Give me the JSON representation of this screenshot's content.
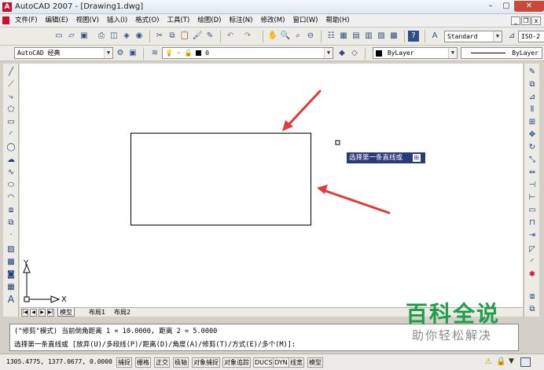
{
  "window": {
    "title": "AutoCAD 2007 - [Drawing1.dwg]",
    "controls": [
      "–",
      "▢",
      "✕"
    ],
    "doc_controls": [
      "_",
      "❐",
      "x"
    ]
  },
  "menu": {
    "items": [
      "文件(F)",
      "编辑(E)",
      "视图(V)",
      "插入(I)",
      "格式(O)",
      "工具(T)",
      "绘图(D)",
      "标注(N)",
      "修改(M)",
      "窗口(W)",
      "帮助(H)"
    ]
  },
  "toolbar": {
    "text_style": "Standard",
    "dim_style": "ISO-2",
    "workspace": "AutoCAD 经典",
    "layer": "0",
    "color": "ByLayer",
    "linetype": "ByLayer"
  },
  "drawing": {
    "tooltip": "选择第一条直线或",
    "tooltip_icon": "⊞",
    "ucs": {
      "x": "X",
      "y": "Y"
    },
    "arrow_color": "#e03a3a"
  },
  "tabs": {
    "items": [
      "模型",
      "布局1",
      "布局2"
    ],
    "nav": [
      "|◀",
      "◀",
      "▶",
      "▶|"
    ]
  },
  "command": {
    "history": "(\"修剪\"模式) 当前倒角距离 1 = 10.0000, 距离 2 = 5.0000",
    "prompt": "选择第一条直线或 [放弃(U)/多段线(P)/距离(D)/角度(A)/修剪(T)/方式(E)/多个(M)]:"
  },
  "status": {
    "coords": "1305.4775, 1377.0677, 0.0000",
    "buttons": [
      "捕捉",
      "栅格",
      "正交",
      "极轴",
      "对象捕捉",
      "对象追踪",
      "DUCS",
      "DYN",
      "线宽",
      "模型"
    ]
  },
  "watermark": {
    "logo": "百科全说",
    "sub": "助你轻松解决"
  }
}
